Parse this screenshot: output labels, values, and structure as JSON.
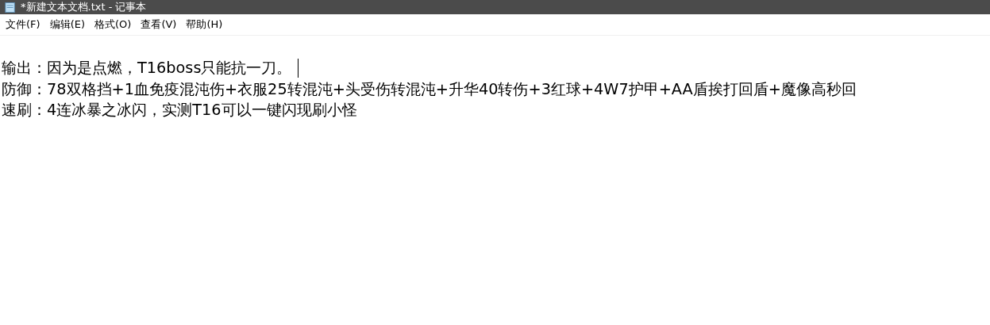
{
  "window": {
    "title": "*新建文本文档.txt - 记事本"
  },
  "menu": [
    "文件(F)",
    "编辑(E)",
    "格式(O)",
    "查看(V)",
    "帮助(H)"
  ],
  "editor": {
    "lines": [
      {
        "text": "输出：因为是点燃，T16boss只能抗一刀。",
        "caret": true
      },
      {
        "text": "防御：78双格挡+1血免疫混沌伤+衣服25转混沌+头受伤转混沌+升华40转伤+3红球+4W7护甲+AA盾挨打回盾+魔像高秒回",
        "caret": false
      },
      {
        "text": "速刷：4连冰暴之冰闪，实测T16可以一键闪现刷小怪",
        "caret": false
      }
    ]
  }
}
